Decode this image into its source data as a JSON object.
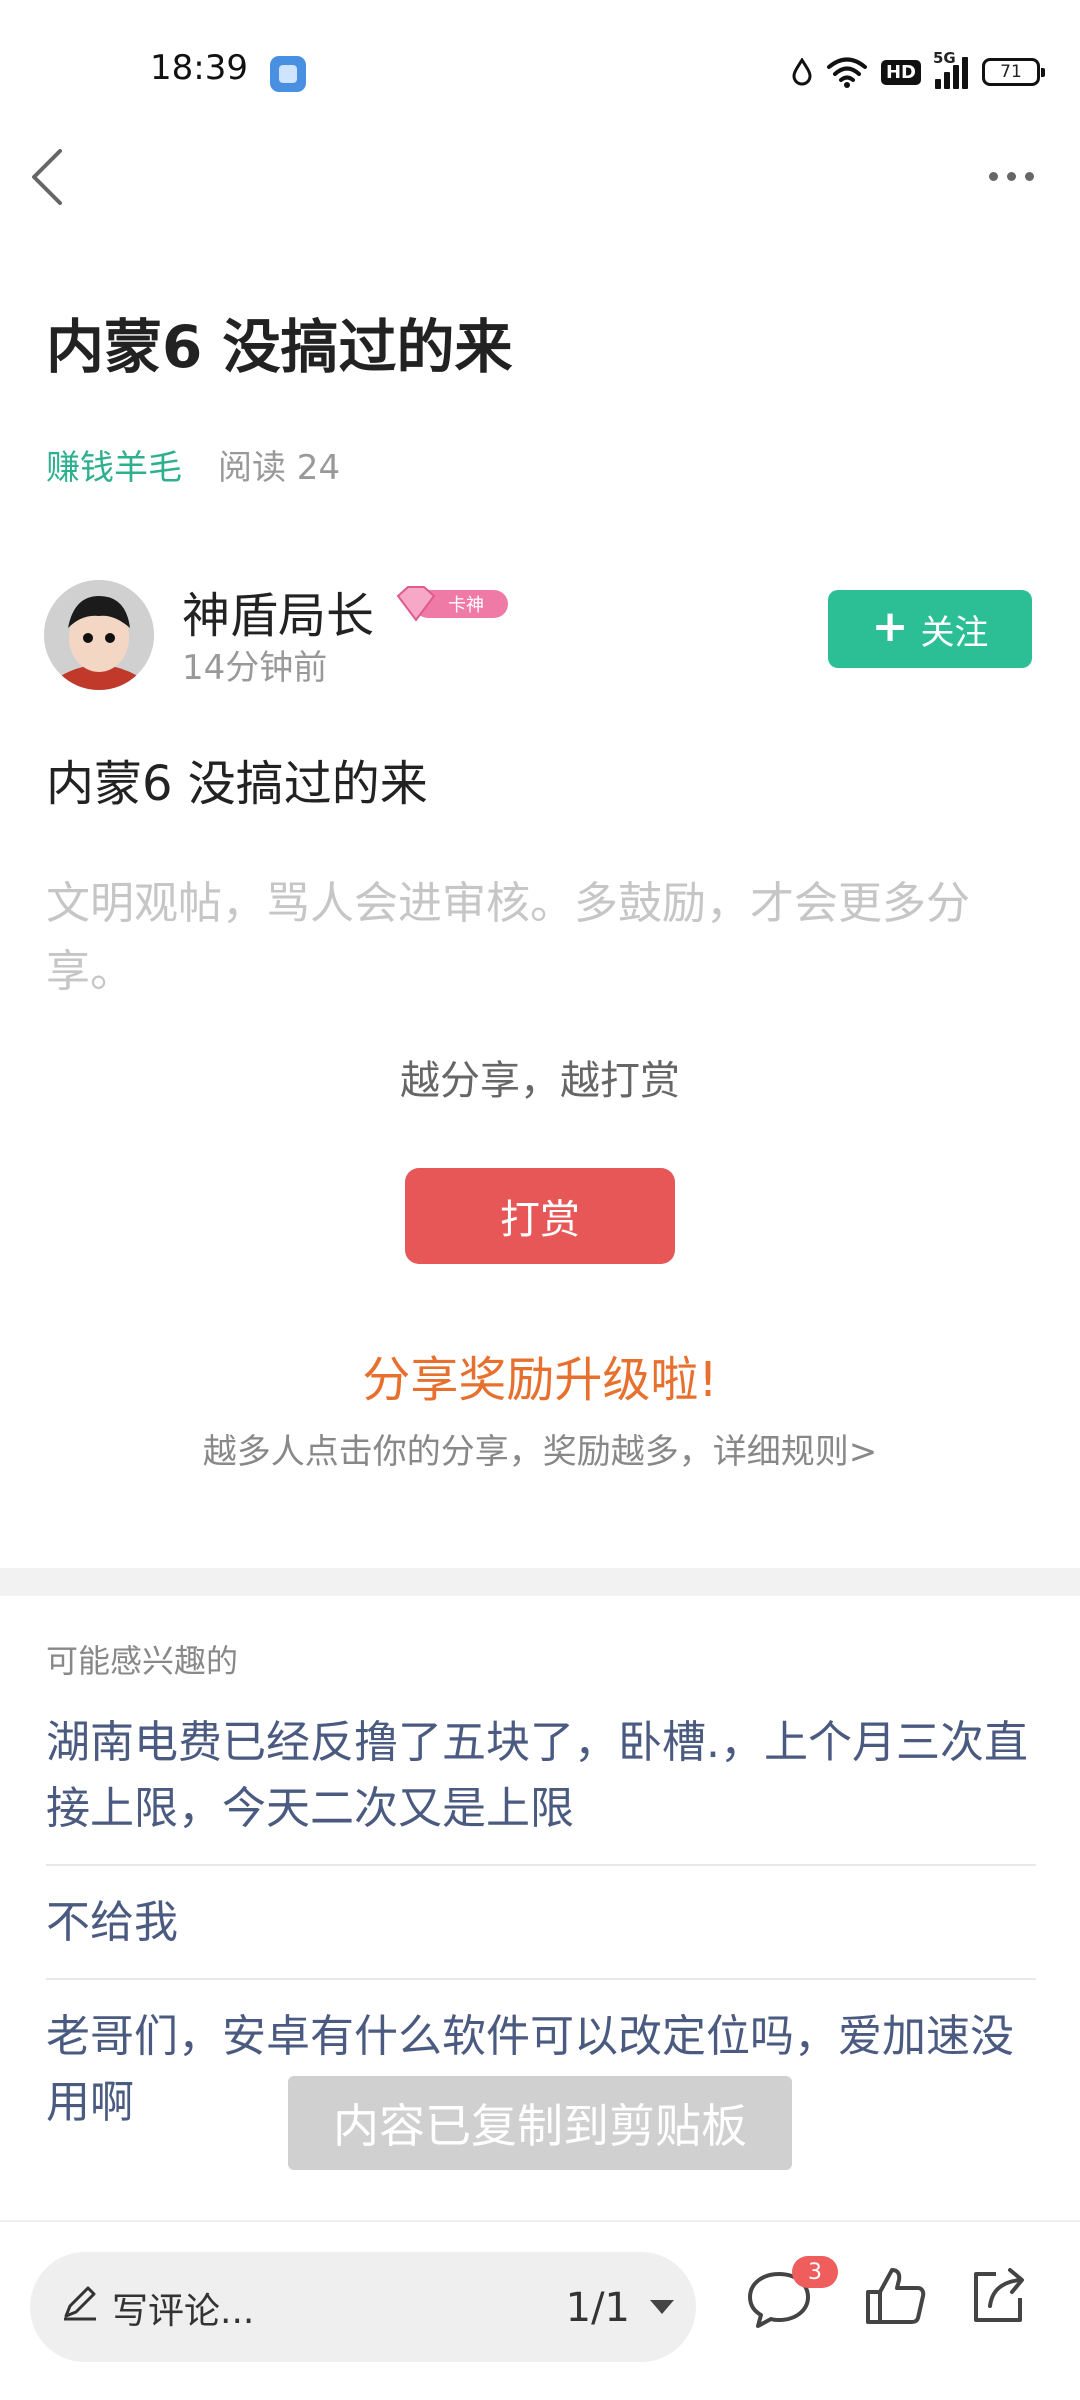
{
  "status_bar": {
    "time": "18:39",
    "network": "5G",
    "hd_label": "HD",
    "battery": "71"
  },
  "nav": {
    "back_icon": "chevron-left-icon",
    "more_icon": "more-horizontal-icon"
  },
  "post": {
    "title": "内蒙6 没搞过的来",
    "category": "赚钱羊毛",
    "read_count": "阅读 24",
    "author": {
      "name": "神盾局长",
      "badge_text": "卡神",
      "time": "14分钟前",
      "follow_label": "关注"
    },
    "content": "内蒙6  没搞过的来",
    "hint": "文明观帖，骂人会进审核。多鼓励，才会更多分享。",
    "reward_slogan": "越分享，越打赏",
    "reward_button": "打赏",
    "share_title": "分享奖励升级啦!",
    "share_subtitle": "越多人点击你的分享，奖励越多，详细规则>"
  },
  "recommendations": {
    "header": "可能感兴趣的",
    "items": [
      "湖南电费已经反撸了五块了，卧槽.，上个月三次直接上限，今天二次又是上限",
      "不给我",
      "老哥们，安卓有什么软件可以改定位吗，爱加速没用啊"
    ]
  },
  "toast": "内容已复制到剪贴板",
  "bottom_bar": {
    "comment_placeholder": "写评论...",
    "page_indicator": "1/1",
    "comment_count": "3"
  },
  "colors": {
    "accent_green": "#2cbf95",
    "reward_red": "#e85757",
    "share_orange": "#e8702f",
    "link_blue": "#4a5a80"
  }
}
